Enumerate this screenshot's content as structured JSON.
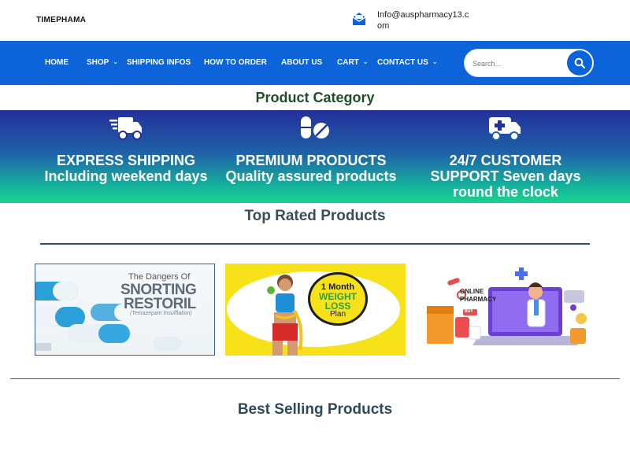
{
  "header": {
    "logo": "TIMEPHAMA",
    "email": "Info@auspharmacy13.com",
    "mail_icon": "envelope-icon"
  },
  "nav": {
    "items": [
      {
        "label": "HOME",
        "has_dropdown": false
      },
      {
        "label": "SHOP",
        "has_dropdown": true
      },
      {
        "label": "SHIPPING INFOS",
        "has_dropdown": false
      },
      {
        "label": "HOW TO ORDER",
        "has_dropdown": false
      },
      {
        "label": "ABOUT US",
        "has_dropdown": false
      },
      {
        "label": "CART",
        "has_dropdown": true
      },
      {
        "label": "CONTACT US",
        "has_dropdown": true
      }
    ],
    "search": {
      "placeholder": "Search...",
      "value": "",
      "icon": "search-icon"
    },
    "bg_color": "#0d64d8"
  },
  "category": {
    "title": "Product Category",
    "features": [
      {
        "icon": "delivery-truck-icon",
        "line1": "EXPRESS SHIPPING",
        "line2": "Including weekend days",
        "line3": ""
      },
      {
        "icon": "pills-icon",
        "line1": "PREMIUM PRODUCTS",
        "line2": "Quality assured products",
        "line3": ""
      },
      {
        "icon": "ambulance-icon",
        "line1": "24/7 CUSTOMER",
        "line2": "SUPPORT Seven days",
        "line3": "round the clock"
      }
    ]
  },
  "top_rated": {
    "title": "Top Rated Products",
    "cards": [
      {
        "image": "capsules-image",
        "lines": [
          "The Dangers Of",
          "SNORTING",
          "RESTORIL",
          "(Temazepam Insufflation)"
        ]
      },
      {
        "image": "weight-loss-image",
        "lines": [
          "1 Month",
          "WEIGHT",
          "LOSS",
          "Plan"
        ]
      },
      {
        "image": "online-pharmacy-image",
        "lines": [
          "ONLINE",
          "PHARMACY",
          "BUY"
        ]
      }
    ]
  },
  "best_selling": {
    "title": "Best Selling Products"
  }
}
